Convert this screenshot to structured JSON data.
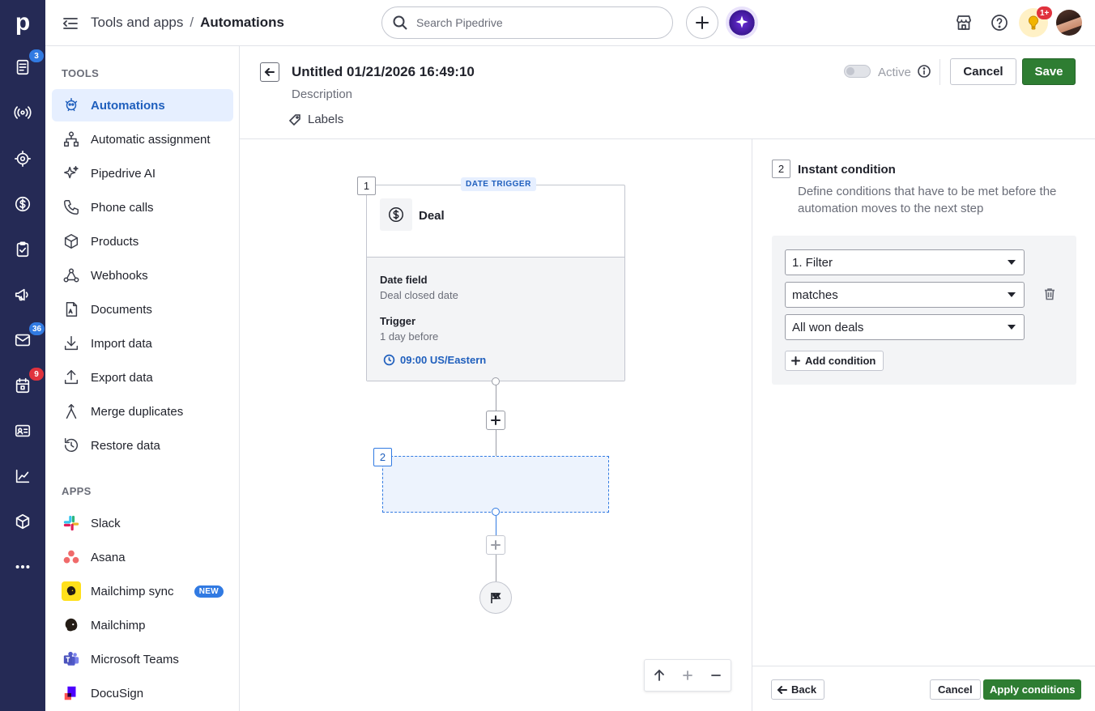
{
  "rail": {
    "logo": "p",
    "items": [
      {
        "icon": "leads-inbox-icon",
        "badge": "3",
        "badge_color": "#317ae2"
      },
      {
        "icon": "campaigns-broadcast-icon",
        "badge": ""
      },
      {
        "icon": "target-icon",
        "badge": ""
      },
      {
        "icon": "deals-dollar-icon",
        "badge": ""
      },
      {
        "icon": "activities-clipboard-icon",
        "badge": ""
      },
      {
        "icon": "megaphone-icon",
        "badge": ""
      },
      {
        "icon": "mail-icon",
        "badge": "36",
        "badge_color": "#317ae2"
      },
      {
        "icon": "calendar-icon",
        "badge": "9",
        "badge_color": "#e0323d"
      },
      {
        "icon": "contacts-card-icon",
        "badge": ""
      },
      {
        "icon": "insights-chart-icon",
        "badge": ""
      },
      {
        "icon": "products-box-icon",
        "badge": ""
      },
      {
        "icon": "more-dots-icon",
        "badge": ""
      }
    ]
  },
  "topbar": {
    "breadcrumb_parent": "Tools and apps",
    "breadcrumb_sep": "/",
    "breadcrumb_current": "Automations",
    "search_placeholder": "Search Pipedrive",
    "notification_badge": "1+"
  },
  "sidebar": {
    "tools_heading": "TOOLS",
    "tools": [
      {
        "label": "Automations",
        "icon": "automation-bot-icon",
        "active": true
      },
      {
        "label": "Automatic assignment",
        "icon": "assignment-tree-icon"
      },
      {
        "label": "Pipedrive AI",
        "icon": "sparkle-icon"
      },
      {
        "label": "Phone calls",
        "icon": "phone-icon"
      },
      {
        "label": "Products",
        "icon": "cube-icon"
      },
      {
        "label": "Webhooks",
        "icon": "webhook-icon"
      },
      {
        "label": "Documents",
        "icon": "document-icon"
      },
      {
        "label": "Import data",
        "icon": "download-icon"
      },
      {
        "label": "Export data",
        "icon": "upload-icon"
      },
      {
        "label": "Merge duplicates",
        "icon": "merge-icon"
      },
      {
        "label": "Restore data",
        "icon": "restore-clock-icon"
      }
    ],
    "apps_heading": "APPS",
    "apps": [
      {
        "label": "Slack",
        "icon": "slack-icon"
      },
      {
        "label": "Asana",
        "icon": "asana-icon"
      },
      {
        "label": "Mailchimp sync",
        "icon": "mailchimp-icon",
        "badge": "NEW"
      },
      {
        "label": "Mailchimp",
        "icon": "mailchimp-icon"
      },
      {
        "label": "Microsoft Teams",
        "icon": "teams-icon"
      },
      {
        "label": "DocuSign",
        "icon": "docusign-icon"
      }
    ]
  },
  "editor": {
    "title": "Untitled 01/21/2026 16:49:10",
    "description_placeholder": "Description",
    "labels_label": "Labels",
    "active_label": "Active",
    "cancel_label": "Cancel",
    "save_label": "Save"
  },
  "flow": {
    "node1": {
      "number": "1",
      "tag": "DATE TRIGGER",
      "entity": "Deal",
      "date_field_label": "Date field",
      "date_field_value": "Deal closed date",
      "trigger_label": "Trigger",
      "trigger_value": "1 day before",
      "time": "09:00 US/Eastern"
    },
    "node2": {
      "number": "2"
    }
  },
  "condition_panel": {
    "step_number": "2",
    "title": "Instant condition",
    "description": "Define conditions that have to be met before the automation moves to the next step",
    "filter_select": "1. Filter",
    "operator_select": "matches",
    "value_select": "All won deals",
    "add_condition_label": "Add condition",
    "back_label": "Back",
    "cancel_label": "Cancel",
    "apply_label": "Apply conditions"
  },
  "colors": {
    "rail_bg": "#252a55",
    "accent_blue": "#317ae2",
    "save_green": "#2e7d32",
    "active_bg": "#e6efff"
  }
}
